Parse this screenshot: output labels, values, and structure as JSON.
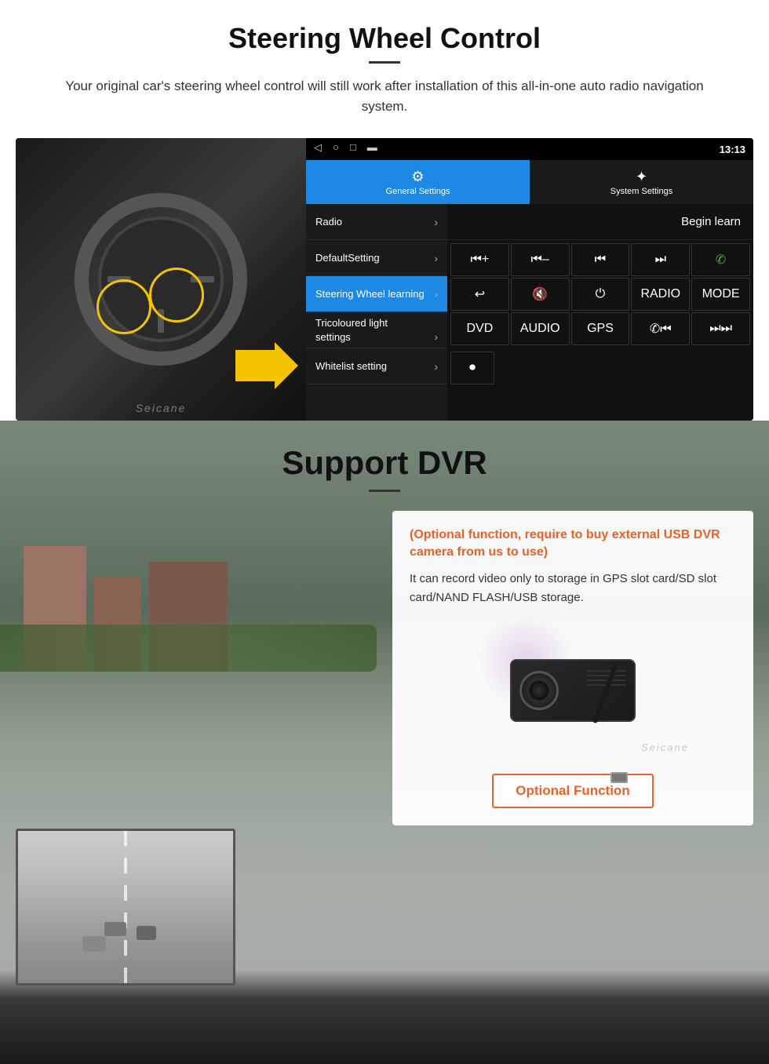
{
  "steering_section": {
    "title": "Steering Wheel Control",
    "description": "Your original car's steering wheel control will still work after installation of this all-in-one auto radio navigation system.",
    "android_ui": {
      "status_bar": {
        "time": "13:13",
        "signal_icon": "▾",
        "wifi_icon": "▾"
      },
      "tabs": [
        {
          "label": "General Settings",
          "icon": "⚙",
          "active": true
        },
        {
          "label": "System Settings",
          "icon": "✦",
          "active": false
        }
      ],
      "menu_items": [
        {
          "label": "Radio",
          "active": false
        },
        {
          "label": "DefaultSetting",
          "active": false
        },
        {
          "label": "Steering Wheel learning",
          "active": true
        },
        {
          "label": "Tricoloured light settings",
          "active": false
        },
        {
          "label": "Whitelist setting",
          "active": false
        }
      ],
      "begin_learn_label": "Begin learn",
      "control_buttons": [
        "⏮+",
        "⏮–",
        "⏮⏮",
        "⏭⏭",
        "📞",
        "↩",
        "🔇",
        "⏻",
        "RADIO",
        "MODE",
        "DVD",
        "AUDIO",
        "GPS",
        "📞⏮",
        "⏭⏭"
      ]
    }
  },
  "dvr_section": {
    "title": "Support DVR",
    "optional_notice": "(Optional function, require to buy external USB DVR camera from us to use)",
    "description": "It can record video only to storage in GPS slot card/SD slot card/NAND FLASH/USB storage.",
    "optional_function_btn": "Optional Function",
    "watermark": "Seicane"
  }
}
